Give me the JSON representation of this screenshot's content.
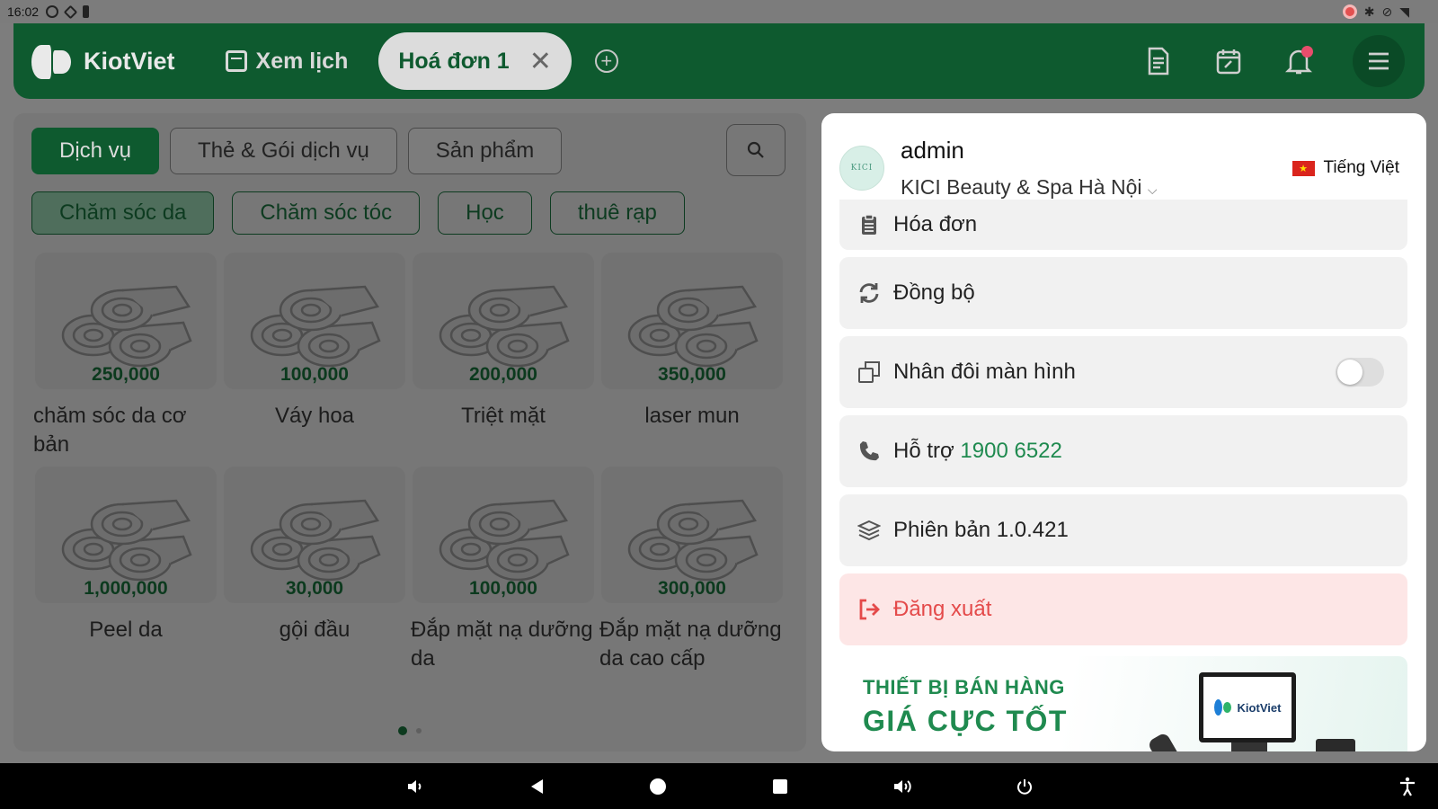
{
  "status_bar": {
    "time": "16:02"
  },
  "header": {
    "brand": "KiotViet",
    "calendar_label": "Xem lịch",
    "active_tab": "Hoá đơn 1"
  },
  "categories": [
    "Dịch vụ",
    "Thẻ & Gói dịch vụ",
    "Sản phẩm"
  ],
  "subcategories": [
    "Chăm sóc da",
    "Chăm sóc tóc",
    "Học",
    "thuê rạp"
  ],
  "products": [
    {
      "price": "250,000",
      "name": "chăm sóc da cơ bản"
    },
    {
      "price": "100,000",
      "name": "Váy hoa"
    },
    {
      "price": "200,000",
      "name": "Triệt mặt"
    },
    {
      "price": "350,000",
      "name": "laser mun"
    },
    {
      "price": "1,000,000",
      "name": "Peel da"
    },
    {
      "price": "30,000",
      "name": "gội đầu"
    },
    {
      "price": "100,000",
      "name": "Đắp mặt nạ dưỡng da"
    },
    {
      "price": "300,000",
      "name": "Đắp mặt nạ dưỡng da cao cấp"
    }
  ],
  "drawer": {
    "user": "admin",
    "avatar_text": "KICI",
    "store": "KICI Beauty & Spa Hà Nội",
    "language": "Tiếng Việt",
    "menu": {
      "invoice": "Hóa đơn",
      "sync": "Đồng bộ",
      "duplicate": "Nhân đôi màn hình",
      "support_label": "Hỗ trợ",
      "support_phone": "1900 6522",
      "version": "Phiên bản 1.0.421",
      "logout": "Đăng xuất"
    },
    "duplicate_enabled": false,
    "banner": {
      "line1": "THIẾT BỊ BÁN HÀNG",
      "line2": "GIÁ CỰC TỐT",
      "device_brand": "KiotViet"
    }
  },
  "colors": {
    "brand_green": "#0e5a2f",
    "accent_green": "#1f8a4f",
    "logout_red": "#e44a4a"
  },
  "icons": [
    "calendar-icon",
    "close-icon",
    "plus-icon",
    "document-icon",
    "calendar-edit-icon",
    "bell-icon",
    "menu-icon",
    "search-icon",
    "clipboard-icon",
    "sync-icon",
    "copy-icon",
    "phone-icon",
    "layers-icon",
    "logout-icon"
  ]
}
